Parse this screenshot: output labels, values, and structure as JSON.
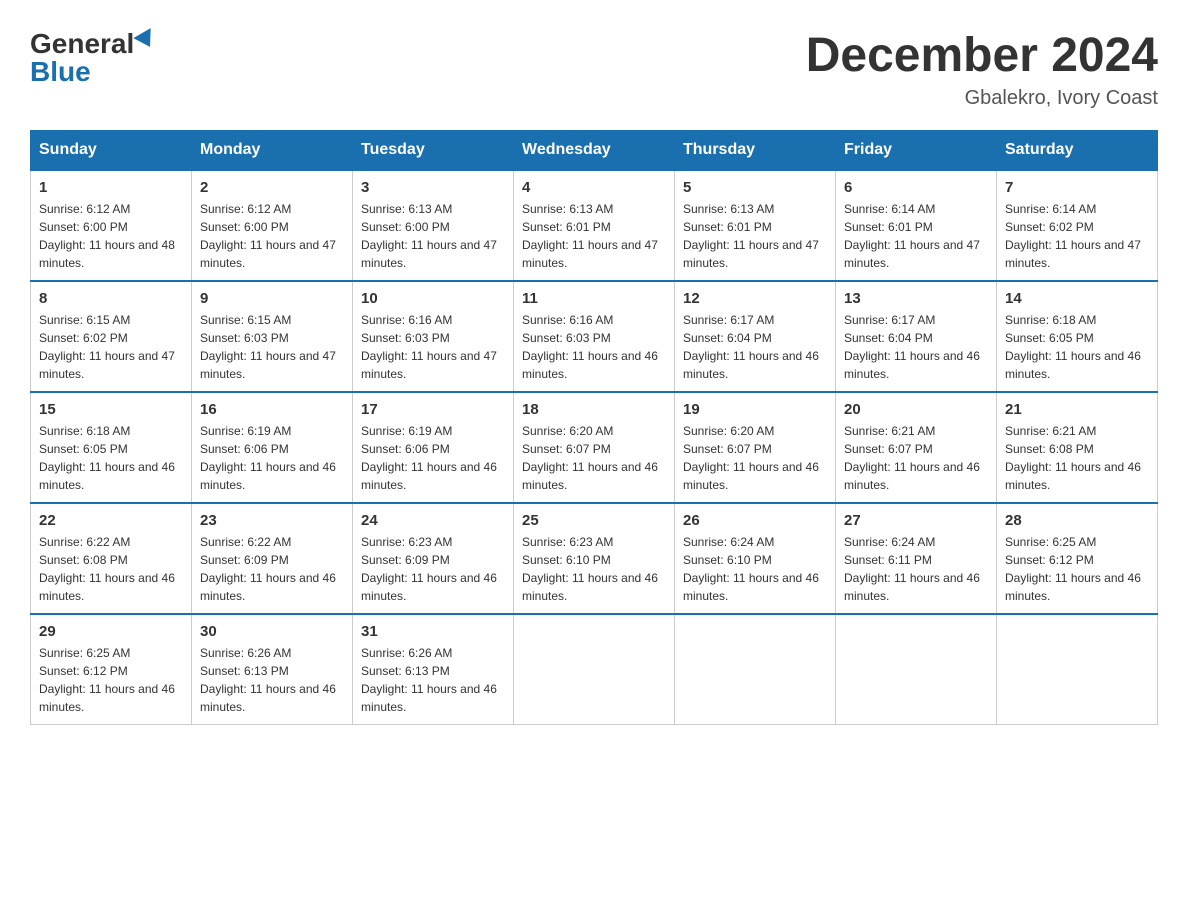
{
  "header": {
    "logo_general": "General",
    "logo_blue": "Blue",
    "month_title": "December 2024",
    "location": "Gbalekro, Ivory Coast"
  },
  "weekdays": [
    "Sunday",
    "Monday",
    "Tuesday",
    "Wednesday",
    "Thursday",
    "Friday",
    "Saturday"
  ],
  "weeks": [
    [
      {
        "day": "1",
        "sunrise": "6:12 AM",
        "sunset": "6:00 PM",
        "daylight": "11 hours and 48 minutes."
      },
      {
        "day": "2",
        "sunrise": "6:12 AM",
        "sunset": "6:00 PM",
        "daylight": "11 hours and 47 minutes."
      },
      {
        "day": "3",
        "sunrise": "6:13 AM",
        "sunset": "6:00 PM",
        "daylight": "11 hours and 47 minutes."
      },
      {
        "day": "4",
        "sunrise": "6:13 AM",
        "sunset": "6:01 PM",
        "daylight": "11 hours and 47 minutes."
      },
      {
        "day": "5",
        "sunrise": "6:13 AM",
        "sunset": "6:01 PM",
        "daylight": "11 hours and 47 minutes."
      },
      {
        "day": "6",
        "sunrise": "6:14 AM",
        "sunset": "6:01 PM",
        "daylight": "11 hours and 47 minutes."
      },
      {
        "day": "7",
        "sunrise": "6:14 AM",
        "sunset": "6:02 PM",
        "daylight": "11 hours and 47 minutes."
      }
    ],
    [
      {
        "day": "8",
        "sunrise": "6:15 AM",
        "sunset": "6:02 PM",
        "daylight": "11 hours and 47 minutes."
      },
      {
        "day": "9",
        "sunrise": "6:15 AM",
        "sunset": "6:03 PM",
        "daylight": "11 hours and 47 minutes."
      },
      {
        "day": "10",
        "sunrise": "6:16 AM",
        "sunset": "6:03 PM",
        "daylight": "11 hours and 47 minutes."
      },
      {
        "day": "11",
        "sunrise": "6:16 AM",
        "sunset": "6:03 PM",
        "daylight": "11 hours and 46 minutes."
      },
      {
        "day": "12",
        "sunrise": "6:17 AM",
        "sunset": "6:04 PM",
        "daylight": "11 hours and 46 minutes."
      },
      {
        "day": "13",
        "sunrise": "6:17 AM",
        "sunset": "6:04 PM",
        "daylight": "11 hours and 46 minutes."
      },
      {
        "day": "14",
        "sunrise": "6:18 AM",
        "sunset": "6:05 PM",
        "daylight": "11 hours and 46 minutes."
      }
    ],
    [
      {
        "day": "15",
        "sunrise": "6:18 AM",
        "sunset": "6:05 PM",
        "daylight": "11 hours and 46 minutes."
      },
      {
        "day": "16",
        "sunrise": "6:19 AM",
        "sunset": "6:06 PM",
        "daylight": "11 hours and 46 minutes."
      },
      {
        "day": "17",
        "sunrise": "6:19 AM",
        "sunset": "6:06 PM",
        "daylight": "11 hours and 46 minutes."
      },
      {
        "day": "18",
        "sunrise": "6:20 AM",
        "sunset": "6:07 PM",
        "daylight": "11 hours and 46 minutes."
      },
      {
        "day": "19",
        "sunrise": "6:20 AM",
        "sunset": "6:07 PM",
        "daylight": "11 hours and 46 minutes."
      },
      {
        "day": "20",
        "sunrise": "6:21 AM",
        "sunset": "6:07 PM",
        "daylight": "11 hours and 46 minutes."
      },
      {
        "day": "21",
        "sunrise": "6:21 AM",
        "sunset": "6:08 PM",
        "daylight": "11 hours and 46 minutes."
      }
    ],
    [
      {
        "day": "22",
        "sunrise": "6:22 AM",
        "sunset": "6:08 PM",
        "daylight": "11 hours and 46 minutes."
      },
      {
        "day": "23",
        "sunrise": "6:22 AM",
        "sunset": "6:09 PM",
        "daylight": "11 hours and 46 minutes."
      },
      {
        "day": "24",
        "sunrise": "6:23 AM",
        "sunset": "6:09 PM",
        "daylight": "11 hours and 46 minutes."
      },
      {
        "day": "25",
        "sunrise": "6:23 AM",
        "sunset": "6:10 PM",
        "daylight": "11 hours and 46 minutes."
      },
      {
        "day": "26",
        "sunrise": "6:24 AM",
        "sunset": "6:10 PM",
        "daylight": "11 hours and 46 minutes."
      },
      {
        "day": "27",
        "sunrise": "6:24 AM",
        "sunset": "6:11 PM",
        "daylight": "11 hours and 46 minutes."
      },
      {
        "day": "28",
        "sunrise": "6:25 AM",
        "sunset": "6:12 PM",
        "daylight": "11 hours and 46 minutes."
      }
    ],
    [
      {
        "day": "29",
        "sunrise": "6:25 AM",
        "sunset": "6:12 PM",
        "daylight": "11 hours and 46 minutes."
      },
      {
        "day": "30",
        "sunrise": "6:26 AM",
        "sunset": "6:13 PM",
        "daylight": "11 hours and 46 minutes."
      },
      {
        "day": "31",
        "sunrise": "6:26 AM",
        "sunset": "6:13 PM",
        "daylight": "11 hours and 46 minutes."
      },
      null,
      null,
      null,
      null
    ]
  ]
}
